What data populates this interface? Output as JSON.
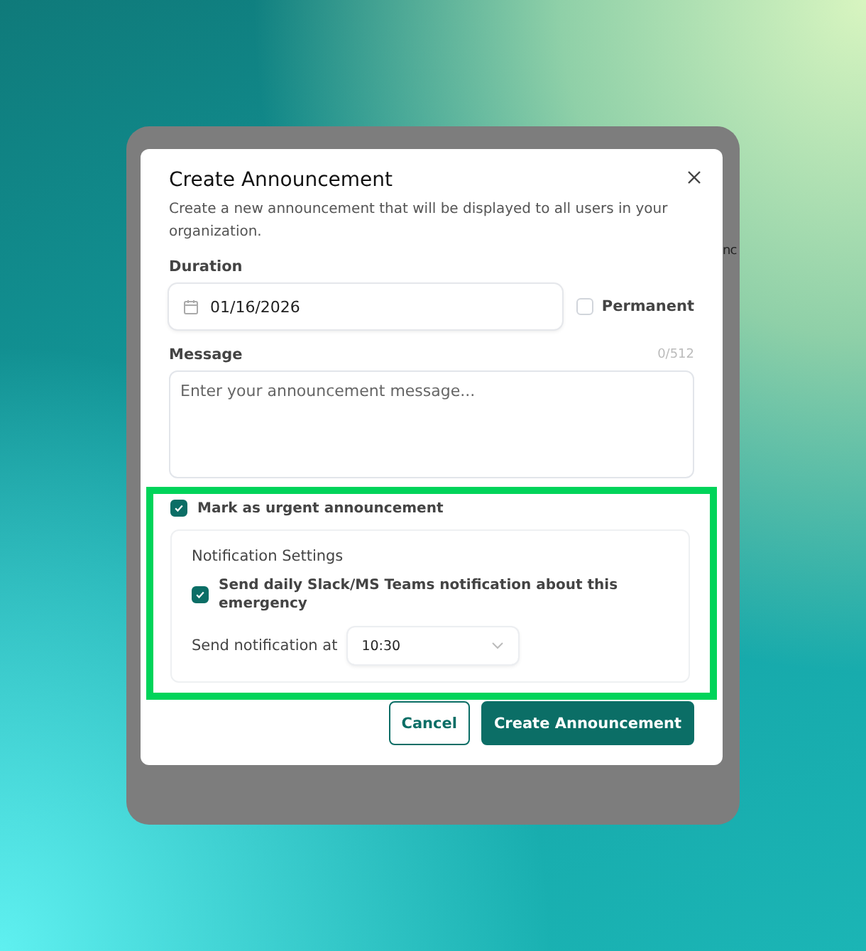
{
  "background_text": "nc",
  "dialog": {
    "title": "Create Announcement",
    "description": "Create a new announcement that will be displayed to all users in your organization.",
    "duration": {
      "label": "Duration",
      "value": "01/16/2026"
    },
    "permanent": {
      "label": "Permanent",
      "checked": false
    },
    "message": {
      "label": "Message",
      "counter": "0/512",
      "placeholder": "Enter your announcement message..."
    },
    "urgent": {
      "label": "Mark as urgent announcement",
      "checked": true
    },
    "notification_settings": {
      "title": "Notification Settings",
      "daily": {
        "label": "Send daily Slack/MS Teams notification about this emergency",
        "checked": true
      },
      "time": {
        "label": "Send notification at",
        "value": "10:30"
      }
    },
    "buttons": [
      {
        "label": "Cancel",
        "kind": "secondary"
      },
      {
        "label": "Create Announcement",
        "kind": "primary"
      }
    ]
  }
}
